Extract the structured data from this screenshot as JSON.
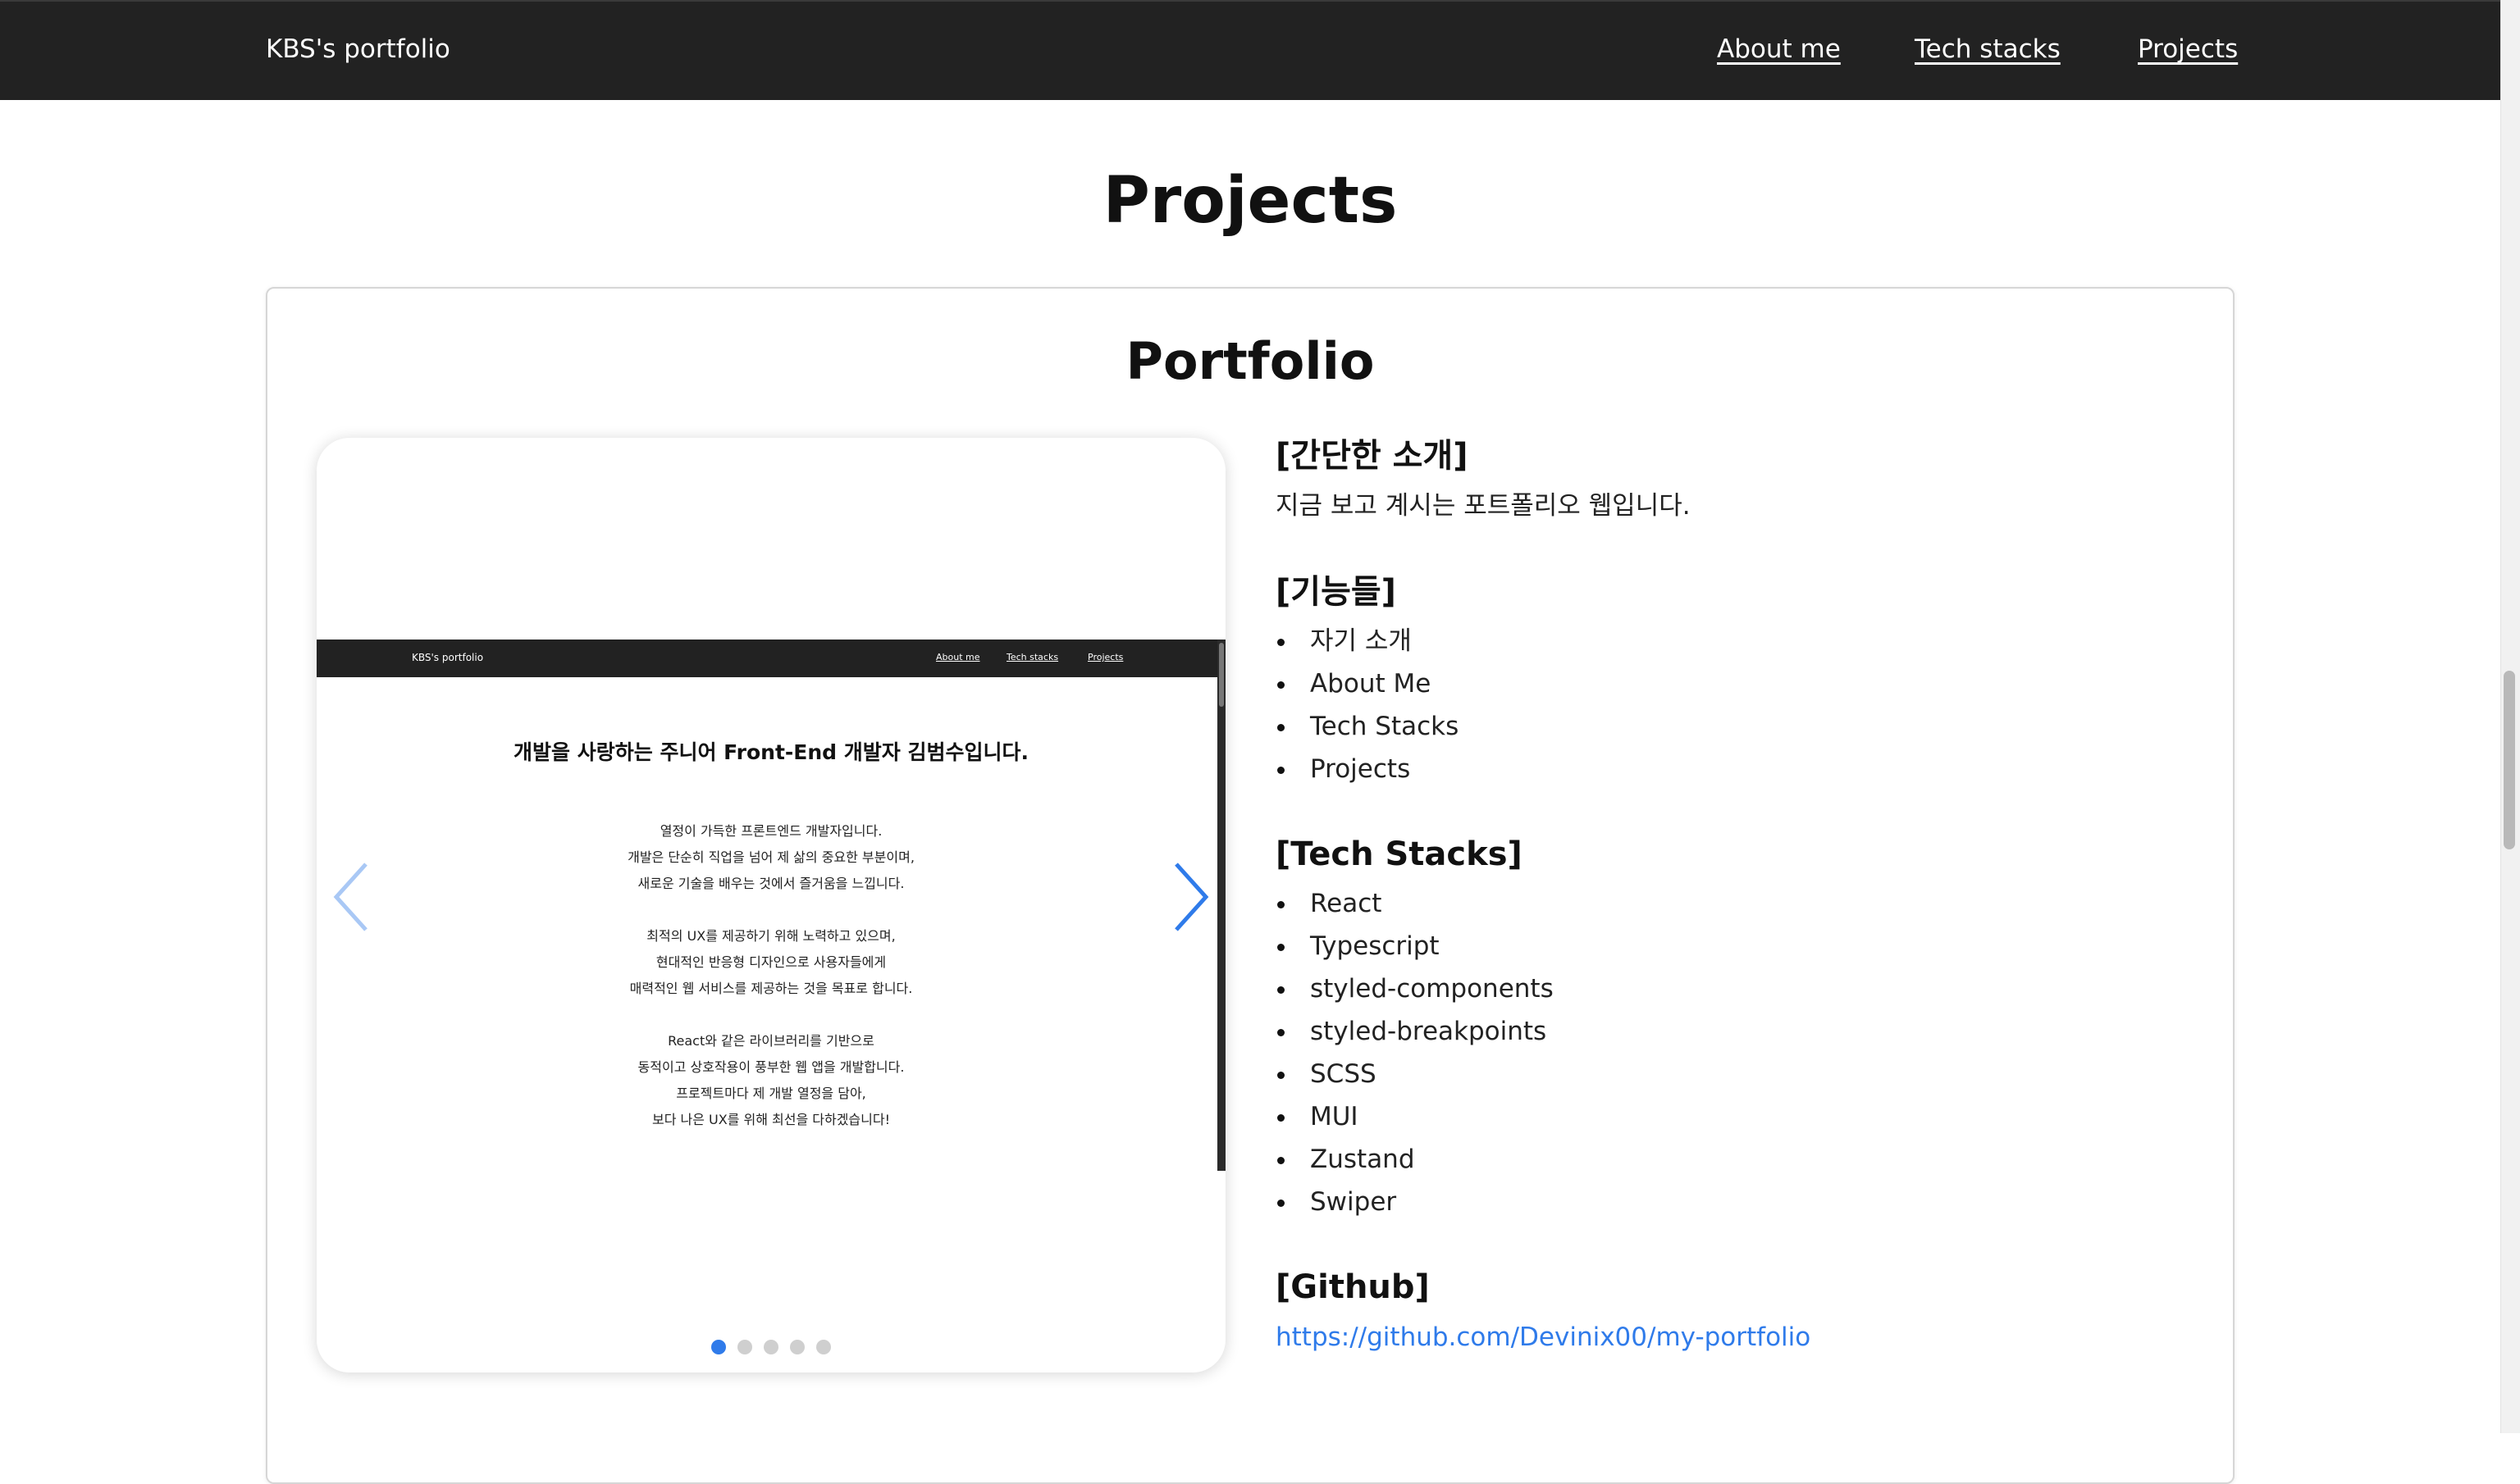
{
  "header": {
    "brand": "KBS's portfolio",
    "nav": [
      "About me",
      "Tech stacks",
      "Projects"
    ]
  },
  "section": {
    "title": "Projects"
  },
  "project": {
    "title": "Portfolio",
    "slider": {
      "preview": {
        "brand": "KBS's portfolio",
        "nav": [
          "About me",
          "Tech stacks",
          "Projects"
        ],
        "heading": "개발을 사랑하는 주니어 Front-End 개발자 김범수입니다.",
        "paragraphs": [
          [
            "열정이 가득한 프론트엔드 개발자입니다.",
            "개발은 단순히 직업을 넘어 제 삶의 중요한 부분이며,",
            "새로운 기술을 배우는 것에서 즐거움을 느낍니다."
          ],
          [
            "최적의 UX를 제공하기 위해 노력하고 있으며,",
            "현대적인 반응형 디자인으로 사용자들에게",
            "매력적인 웹 서비스를 제공하는 것을 목표로 합니다."
          ],
          [
            "React와 같은 라이브러리를 기반으로",
            "동적이고 상호작용이 풍부한 웹 앱을 개발합니다."
          ],
          [
            "프로젝트마다 제 개발 열정을 담아,",
            "보다 나은 UX를 위해 최선을 다하겠습니다!"
          ]
        ]
      },
      "slide_count": 5,
      "active_index": 0,
      "accent_color": "#2f7bea",
      "prev_icon": "chevron-left-icon",
      "next_icon": "chevron-right-icon"
    },
    "intro": {
      "heading": "[간단한 소개]",
      "text": "지금 보고 계시는 포트폴리오 웹입니다."
    },
    "features": {
      "heading": "[기능들]",
      "items": [
        "자기 소개",
        "About Me",
        "Tech Stacks",
        "Projects"
      ]
    },
    "tech": {
      "heading": "[Tech Stacks]",
      "items": [
        "React",
        "Typescript",
        "styled-components",
        "styled-breakpoints",
        "SCSS",
        "MUI",
        "Zustand",
        "Swiper"
      ]
    },
    "github": {
      "heading": "[Github]",
      "url": "https://github.com/Devinix00/my-portfolio"
    }
  }
}
